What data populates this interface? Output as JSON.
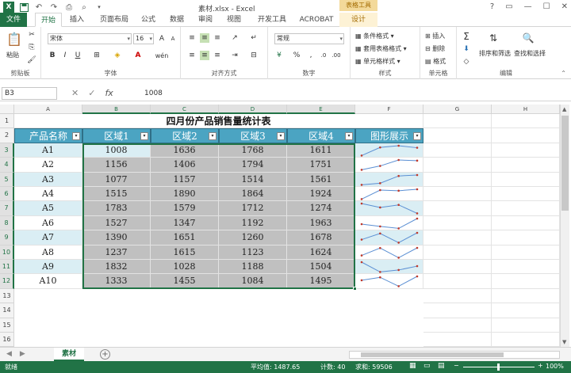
{
  "window": {
    "title": "素材.xlsx - Excel",
    "context_band": "表格工具"
  },
  "tabs": [
    "文件",
    "开始",
    "插入",
    "页面布局",
    "公式",
    "数据",
    "审阅",
    "视图",
    "开发工具",
    "ACROBAT",
    "设计"
  ],
  "ribbon": {
    "clipboard": {
      "paste": "粘贴",
      "label": "剪贴板"
    },
    "font": {
      "name": "宋体",
      "size": "16",
      "label": "字体"
    },
    "align": {
      "label": "对齐方式"
    },
    "number": {
      "format": "常规",
      "label": "数字"
    },
    "styles": {
      "cond": "条件格式",
      "table": "套用表格格式",
      "cell": "单元格样式",
      "label": "样式"
    },
    "cells": {
      "insert": "插入",
      "delete": "删除",
      "format": "格式",
      "label": "单元格"
    },
    "editing": {
      "sort": "排序和筛选",
      "find": "查找和选择",
      "label": "编辑"
    }
  },
  "formula_bar": {
    "name_box": "B3",
    "value": "1008"
  },
  "columns": [
    "A",
    "B",
    "C",
    "D",
    "E",
    "F",
    "G",
    "H"
  ],
  "rows": [
    "1",
    "2",
    "3",
    "4",
    "5",
    "6",
    "7",
    "8",
    "9",
    "10",
    "11",
    "12",
    "13",
    "14",
    "15",
    "16"
  ],
  "sheet": {
    "title": "四月份产品销售量统计表",
    "headers": [
      "产品名称",
      "区域1",
      "区域2",
      "区域3",
      "区域4",
      "图形展示"
    ],
    "table": [
      [
        "A1",
        "1008",
        "1636",
        "1768",
        "1611"
      ],
      [
        "A2",
        "1156",
        "1406",
        "1794",
        "1751"
      ],
      [
        "A3",
        "1077",
        "1157",
        "1514",
        "1561"
      ],
      [
        "A4",
        "1515",
        "1890",
        "1864",
        "1924"
      ],
      [
        "A5",
        "1783",
        "1579",
        "1712",
        "1274"
      ],
      [
        "A6",
        "1527",
        "1347",
        "1192",
        "1963"
      ],
      [
        "A7",
        "1390",
        "1651",
        "1260",
        "1678"
      ],
      [
        "A8",
        "1237",
        "1615",
        "1123",
        "1624"
      ],
      [
        "A9",
        "1832",
        "1028",
        "1188",
        "1504"
      ],
      [
        "A10",
        "1333",
        "1455",
        "1084",
        "1495"
      ]
    ]
  },
  "sheet_tab": "素材",
  "status": {
    "ready": "就绪",
    "average": "平均值: 1487.65",
    "count": "计数: 40",
    "sum": "求和: 59506",
    "zoom": "100%"
  },
  "colors": {
    "accent": "#217346",
    "header": "#4ba4c2",
    "light": "#daeef4",
    "gray": "#c0c0c0",
    "spark": "#5b8fd3",
    "marker": "#c0392b"
  }
}
